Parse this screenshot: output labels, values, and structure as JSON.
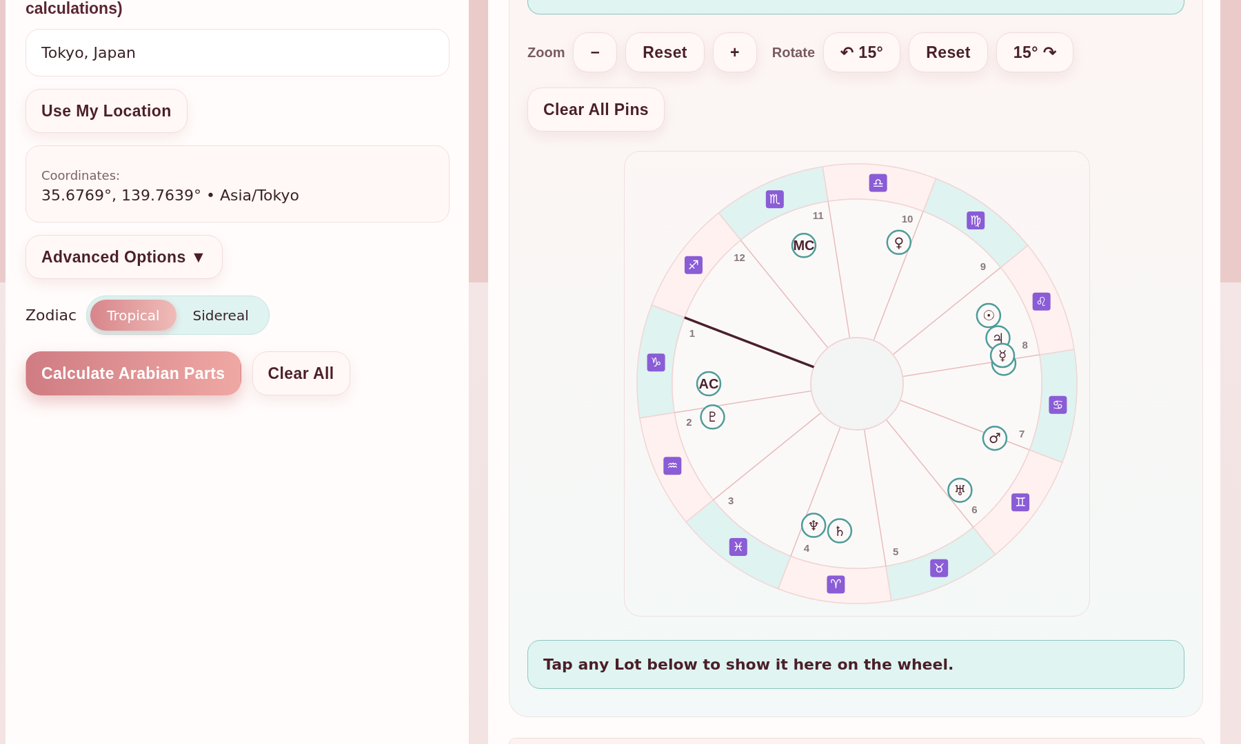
{
  "heading": "calculations)",
  "location_field": {
    "value": "Tokyo, Japan"
  },
  "location_button": "Use My Location",
  "coordinates": {
    "label": "Coordinates:",
    "value": "35.6769°, 139.7639° • Asia/Tokyo"
  },
  "advanced_button": "Advanced Options ▼",
  "zodiac": {
    "label": "Zodiac",
    "options": [
      {
        "label": "Tropical",
        "selected": true
      },
      {
        "label": "Sidereal",
        "selected": false
      }
    ]
  },
  "actions": [
    {
      "label": "Calculate Arabian Parts",
      "kind": "primary"
    },
    {
      "label": "Clear All",
      "kind": "secondary"
    }
  ],
  "toolbar": {
    "zoom_label": "Zoom",
    "zoom_buttons": [
      "−",
      "Reset",
      "+"
    ],
    "rotate_label": "Rotate",
    "rotate_buttons": [
      "↶ 15°",
      "Reset",
      "15° ↷"
    ]
  },
  "clear_pins_button": "Clear All Pins",
  "wheel": {
    "signs": [
      "♈",
      "♉",
      "♊",
      "♋",
      "♌",
      "♍",
      "♎",
      "♏",
      "♐",
      "♑",
      "♒",
      "♓"
    ],
    "houses": [
      "1",
      "2",
      "3",
      "4",
      "5",
      "6",
      "7",
      "8",
      "9",
      "10",
      "11",
      "12"
    ],
    "points": [
      {
        "symbol": "MC",
        "kind": "angle"
      },
      {
        "symbol": "♀",
        "kind": "planet"
      },
      {
        "symbol": "☉",
        "kind": "planet"
      },
      {
        "symbol": "♃",
        "kind": "planet"
      },
      {
        "kind": "blank"
      },
      {
        "symbol": "☿",
        "kind": "planet"
      },
      {
        "symbol": "AC",
        "kind": "angle"
      },
      {
        "symbol": "♇",
        "kind": "planet"
      },
      {
        "symbol": "♂",
        "kind": "planet"
      },
      {
        "symbol": "♅",
        "kind": "planet"
      },
      {
        "symbol": "♆",
        "kind": "planet"
      },
      {
        "symbol": "♄",
        "kind": "planet"
      }
    ]
  },
  "hint": "Tap any Lot below to show it here on the wheel."
}
